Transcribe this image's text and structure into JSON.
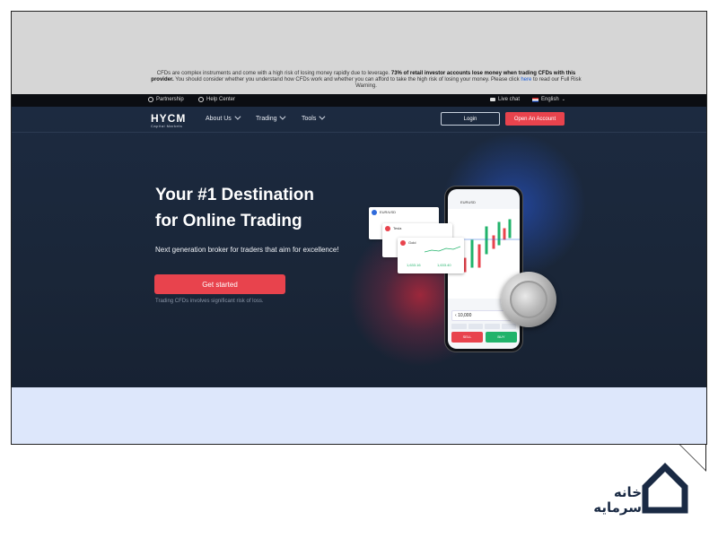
{
  "warning": {
    "text1": "CFDs are complex instruments and come with a high risk of losing money rapidly due to leverage. ",
    "bold": "73% of retail investor accounts lose money when trading CFDs with this provider.",
    "text2": " You should consider whether you understand how CFDs work and whether you can afford to take the high risk of losing your money. Please click ",
    "link": "here",
    "text3": " to read our Full Risk Warning."
  },
  "utilbar": {
    "partnership": "Partnership",
    "help": "Help Center",
    "live_chat": "Live chat",
    "language": "English"
  },
  "nav": {
    "logo_main": "HYCM",
    "logo_sub": "Capital Markets",
    "about": "About Us",
    "trading": "Trading",
    "tools": "Tools",
    "login": "Login",
    "open_account": "Open An Account"
  },
  "hero": {
    "headline_line1": "Your #1 Destination",
    "headline_line2": "for Online Trading",
    "subline": "Next generation broker for traders that aim for excellence!",
    "cta": "Get started",
    "risk": "Trading CFDs involves significant risk of loss."
  },
  "phone": {
    "symbol": "EURUSD",
    "amount": "10,000",
    "sell": "SELL",
    "buy": "BUY"
  },
  "cards": {
    "c1_title": "EUR/USD",
    "c2_title": "Tesla",
    "c3_title": "Gold",
    "c3_sell": "1,633.16",
    "c3_buy": "1,633.40"
  },
  "watermark": {
    "line1": "خانه",
    "line2": "سرمایه"
  },
  "colors": {
    "accent_red": "#e8434d",
    "navy": "#1c2a40",
    "buy_green": "#21b36b"
  }
}
